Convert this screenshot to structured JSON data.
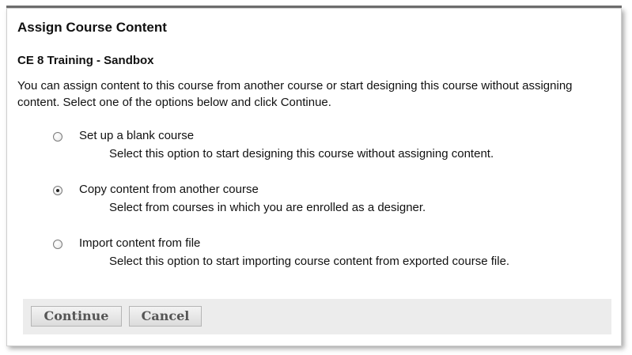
{
  "dialog": {
    "title": "Assign Course Content",
    "course_name": "CE 8 Training - Sandbox",
    "intro_text": "You can assign content to this course from another course or start designing this course without assigning content. Select one of the options below and click Continue."
  },
  "options": [
    {
      "label": "Set up a blank course",
      "description": "Select this option to start designing this course without assigning content.",
      "selected": false
    },
    {
      "label": "Copy content from another course",
      "description": "Select from courses in which you are enrolled as a designer.",
      "selected": true
    },
    {
      "label": "Import content from file",
      "description": "Select this option to start importing course content from exported course file.",
      "selected": false
    }
  ],
  "buttons": {
    "continue_label": "Continue",
    "cancel_label": "Cancel"
  }
}
